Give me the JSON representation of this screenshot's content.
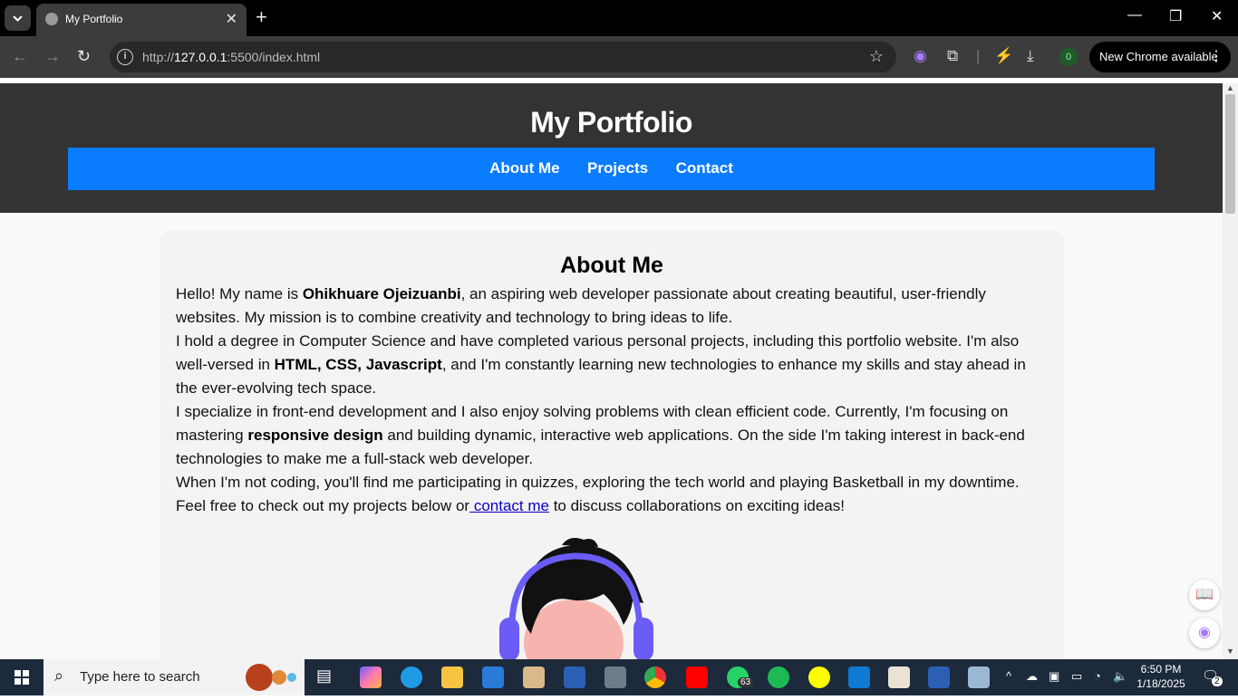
{
  "browser": {
    "tab_title": "My Portfolio",
    "url_host": "127.0.0.1",
    "url_prefix": "http://",
    "url_suffix": ":5500/index.html",
    "extension_badge": "0",
    "update_label": "New Chrome available"
  },
  "site": {
    "title": "My Portfolio",
    "nav": [
      "About Me",
      "Projects",
      "Contact"
    ]
  },
  "about": {
    "heading": "About Me",
    "p1_a": "Hello! My name is ",
    "p1_name": "Ohikhuare Ojeizuanbi",
    "p1_b": ", an aspiring web developer passionate about creating beautiful, user-friendly websites. My mission is to combine creativity and technology to bring ideas to life.",
    "p2_a": "I hold a degree in Computer Science and have completed various personal projects, including this portfolio website. I'm also well-versed in ",
    "p2_skills": "HTML, CSS, Javascript",
    "p2_b": ", and I'm constantly learning new technologies to enhance my skills and stay ahead in the ever-evolving tech space.",
    "p3_a": "I specialize in front-end development and I also enjoy solving problems with clean efficient code. Currently, I'm focusing on mastering ",
    "p3_focus": "responsive design",
    "p3_b": " and building dynamic, interactive web applications. On the side I'm taking interest in back-end technologies to make me a full-stack web developer.",
    "p4_a": "When I'm not coding, you'll find me participating in quizzes, exploring the tech world and playing Basketball in my downtime. Feel free to check out my projects below or",
    "p4_link": " contact me",
    "p4_b": " to discuss collaborations on exciting ideas!"
  },
  "taskbar": {
    "search_placeholder": "Type here to search",
    "whatsapp_badge": "63",
    "time": "6:50 PM",
    "date": "1/18/2025",
    "notifications": "2"
  },
  "colors": {
    "header_bg": "#333333",
    "nav_bg": "#0a7cff",
    "card_bg": "#f3f3f3",
    "link": "#0a00c8"
  }
}
